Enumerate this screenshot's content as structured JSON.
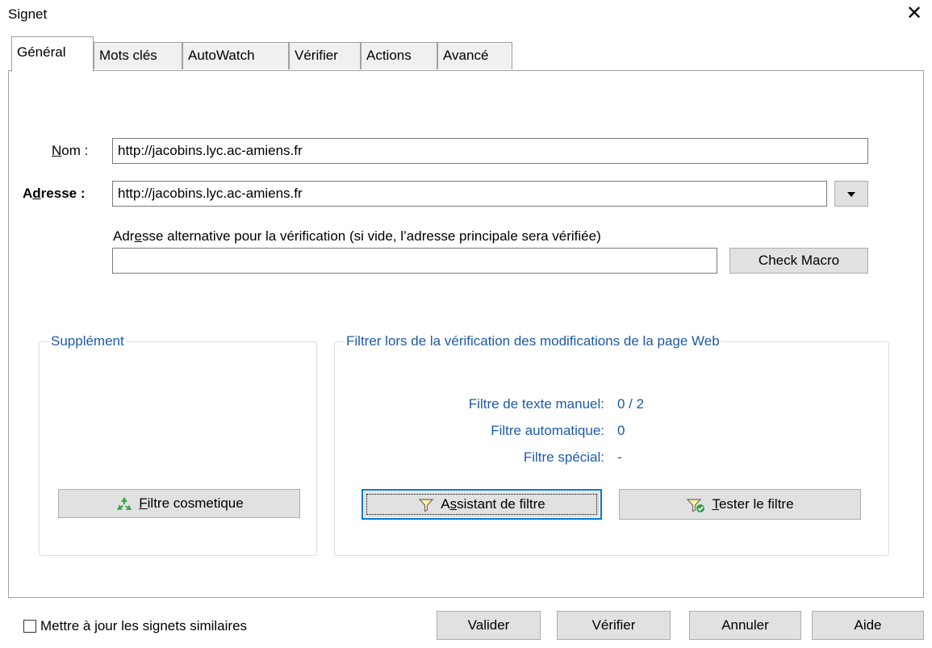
{
  "window": {
    "title": "Signet",
    "close_glyph": "✕"
  },
  "tabs": [
    {
      "label": "Général",
      "active": true
    },
    {
      "label": "Mots clés"
    },
    {
      "label": "AutoWatch"
    },
    {
      "label": "Vérifier"
    },
    {
      "label": "Actions"
    },
    {
      "label": "Avancé"
    }
  ],
  "form": {
    "nom_label_pre": "N",
    "nom_label_post": "om :",
    "nom_value": "http://jacobins.lyc.ac-amiens.fr",
    "adresse_label_pre": "A",
    "adresse_label_u": "d",
    "adresse_label_post": "resse :",
    "adresse_value": "http://jacobins.lyc.ac-amiens.fr",
    "alt_label_pre": "Adr",
    "alt_label_u": "e",
    "alt_label_post": "sse alternative pour la vérification (si vide, l’adresse principale sera vérifiée)",
    "alt_value": "",
    "check_macro": "Check Macro"
  },
  "supplement": {
    "legend": "Supplément",
    "button_u": "F",
    "button_rest": "iltre cosmetique",
    "icon": "recycle-icon"
  },
  "filter": {
    "legend": "Filtrer lors de la vérification des modifications de la page Web",
    "rows": [
      {
        "label": "Filtre de texte manuel:",
        "value": "0 / 2"
      },
      {
        "label": "Filtre automatique:",
        "value": "0"
      },
      {
        "label": "Filtre spécial:",
        "value": "-"
      }
    ],
    "assistant_pre": "A",
    "assistant_u": "s",
    "assistant_post": "sistant de filtre",
    "tester_u": "T",
    "tester_post": "ester le filtre"
  },
  "footer": {
    "checkbox_label": "Mettre à jour les signets similaires",
    "checkbox_checked": false,
    "valider": "Valider",
    "verifier": "Vérifier",
    "annuler": "Annuler",
    "aide": "Aide"
  },
  "colors": {
    "accent": "#0078d7",
    "group_text": "#1e5aa8",
    "button_bg": "#e1e1e1"
  }
}
